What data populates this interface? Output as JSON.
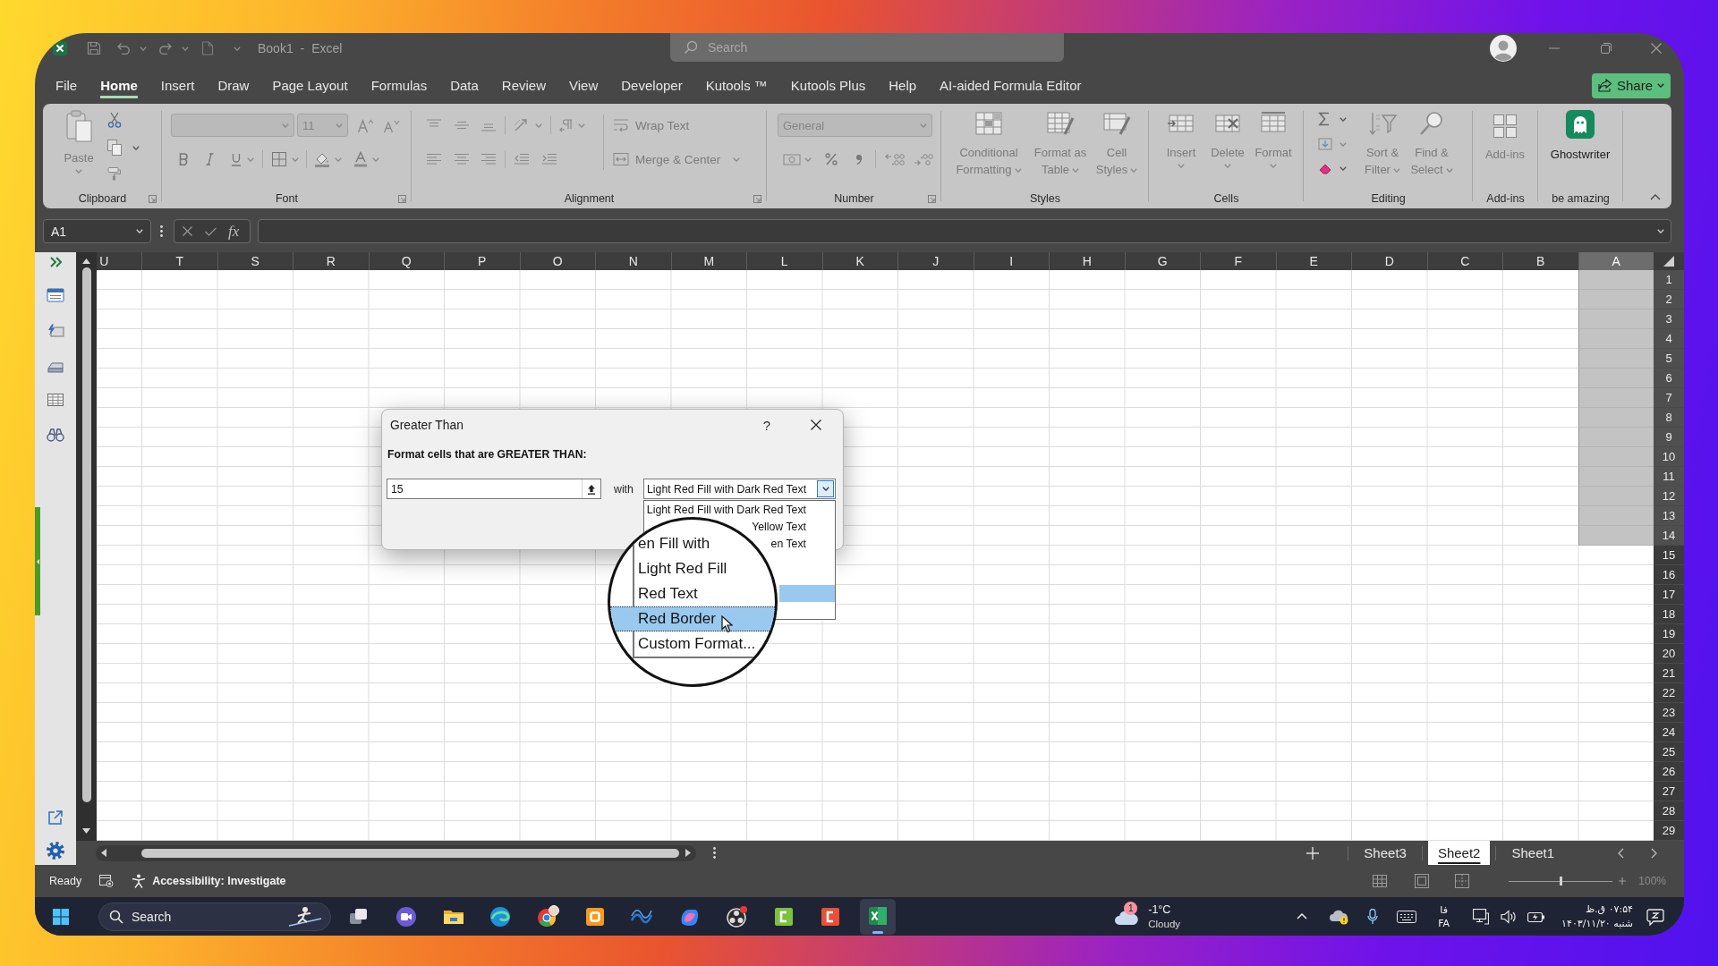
{
  "title_bar": {
    "title": "Book1 - Excel",
    "search": {
      "placeholder": "Search"
    }
  },
  "menu_tabs": [
    {
      "label": "File",
      "selected": false
    },
    {
      "label": "Home",
      "selected": true
    },
    {
      "label": "Insert",
      "selected": false
    },
    {
      "label": "Draw",
      "selected": false
    },
    {
      "label": "Page Layout",
      "selected": false
    },
    {
      "label": "Formulas",
      "selected": false
    },
    {
      "label": "Data",
      "selected": false
    },
    {
      "label": "Review",
      "selected": false
    },
    {
      "label": "View",
      "selected": false
    },
    {
      "label": "Developer",
      "selected": false
    },
    {
      "label": "Kutools ™",
      "selected": false
    },
    {
      "label": "Kutools Plus",
      "selected": false
    },
    {
      "label": "Help",
      "selected": false
    },
    {
      "label": "AI-aided Formula Editor",
      "selected": false
    }
  ],
  "share_button": {
    "label": "Share"
  },
  "ribbon": {
    "groups": [
      {
        "kind": "clipboard",
        "label": "Clipboard",
        "commands": [
          {
            "label": "Paste",
            "disabled": true
          }
        ]
      },
      {
        "kind": "font",
        "label": "Font",
        "font_size": "11"
      },
      {
        "kind": "alignment",
        "label": "Alignment",
        "commands": [
          {
            "label": "Wrap Text",
            "disabled": true
          },
          {
            "label": "Merge & Center",
            "disabled": true
          }
        ]
      },
      {
        "kind": "number",
        "label": "Number",
        "number_format": "General"
      },
      {
        "kind": "styles",
        "label": "Styles",
        "commands": [
          {
            "label": "Conditional Formatting",
            "disabled": true
          },
          {
            "label": "Format as Table",
            "disabled": true
          },
          {
            "label": "Cell Styles",
            "disabled": true
          }
        ]
      },
      {
        "kind": "cells",
        "label": "Cells",
        "commands": [
          {
            "label": "Insert",
            "disabled": true
          },
          {
            "label": "Delete",
            "disabled": true
          },
          {
            "label": "Format",
            "disabled": true
          }
        ]
      },
      {
        "kind": "editing",
        "label": "Editing",
        "commands": [
          {
            "label": "Sort & Filter",
            "disabled": true
          },
          {
            "label": "Find & Select",
            "disabled": true
          }
        ]
      },
      {
        "kind": "addins",
        "label": "Add-ins",
        "commands": [
          {
            "label": "Add-ins",
            "disabled": true
          }
        ]
      },
      {
        "kind": "ghostwriter",
        "label": "be amazing",
        "commands": [
          {
            "label": "Ghostwriter",
            "disabled": false
          }
        ]
      }
    ]
  },
  "formula_bar": {
    "name_box": "A1",
    "function_button": "fx"
  },
  "sheet": {
    "columns": [
      {
        "label": "U",
        "selected": false
      },
      {
        "label": "T",
        "selected": false
      },
      {
        "label": "S",
        "selected": false
      },
      {
        "label": "R",
        "selected": false
      },
      {
        "label": "Q",
        "selected": false
      },
      {
        "label": "P",
        "selected": false
      },
      {
        "label": "O",
        "selected": false
      },
      {
        "label": "N",
        "selected": false
      },
      {
        "label": "M",
        "selected": false
      },
      {
        "label": "L",
        "selected": false
      },
      {
        "label": "K",
        "selected": false
      },
      {
        "label": "J",
        "selected": false
      },
      {
        "label": "I",
        "selected": false
      },
      {
        "label": "H",
        "selected": false
      },
      {
        "label": "G",
        "selected": false
      },
      {
        "label": "F",
        "selected": false
      },
      {
        "label": "E",
        "selected": false
      },
      {
        "label": "D",
        "selected": false
      },
      {
        "label": "C",
        "selected": false
      },
      {
        "label": "B",
        "selected": false
      },
      {
        "label": "A",
        "selected": true
      }
    ],
    "rows": [
      {
        "label": "1",
        "selected": true
      },
      {
        "label": "2",
        "selected": true
      },
      {
        "label": "3",
        "selected": true
      },
      {
        "label": "4",
        "selected": true
      },
      {
        "label": "5",
        "selected": true
      },
      {
        "label": "6",
        "selected": true
      },
      {
        "label": "7",
        "selected": true
      },
      {
        "label": "8",
        "selected": true
      },
      {
        "label": "9",
        "selected": true
      },
      {
        "label": "10",
        "selected": true
      },
      {
        "label": "11",
        "selected": true
      },
      {
        "label": "12",
        "selected": true
      },
      {
        "label": "13",
        "selected": true
      },
      {
        "label": "14",
        "selected": true
      },
      {
        "label": "15",
        "selected": false
      },
      {
        "label": "16",
        "selected": false
      },
      {
        "label": "17",
        "selected": false
      },
      {
        "label": "18",
        "selected": false
      },
      {
        "label": "19",
        "selected": false
      },
      {
        "label": "20",
        "selected": false
      },
      {
        "label": "21",
        "selected": false
      },
      {
        "label": "22",
        "selected": false
      },
      {
        "label": "23",
        "selected": false
      },
      {
        "label": "24",
        "selected": false
      },
      {
        "label": "25",
        "selected": false
      },
      {
        "label": "26",
        "selected": false
      },
      {
        "label": "27",
        "selected": false
      },
      {
        "label": "28",
        "selected": false
      },
      {
        "label": "29",
        "selected": false
      }
    ]
  },
  "sheet_tabs": [
    {
      "label": "Sheet3",
      "selected": false
    },
    {
      "label": "Sheet2",
      "selected": true
    },
    {
      "label": "Sheet1",
      "selected": false
    }
  ],
  "status_bar": {
    "status": "Ready",
    "accessibility": "Accessibility: Investigate",
    "zoom_slider": {
      "level": 0.5
    },
    "zoom": "100%"
  },
  "dialog": {
    "title": "Greater Than",
    "help_button": "?",
    "prompt": "Format cells that are GREATER THAN:",
    "value": "15",
    "with_label": "with",
    "format": "Light Red Fill with Dark Red Text",
    "format_list": [
      {
        "label": "Light Red Fill with Dark Red Text",
        "selected": false
      },
      {
        "label": "Yellow Text",
        "selected": false
      },
      {
        "label": "en Text",
        "selected": false
      },
      {
        "selected": true
      }
    ]
  },
  "magnifier": {
    "items": [
      {
        "label": "en Fill with",
        "selected": false
      },
      {
        "label": "Light Red Fill",
        "selected": false
      },
      {
        "label": "Red Text",
        "selected": false
      },
      {
        "label": "Red Border",
        "selected": true
      },
      {
        "label": "Custom Format...",
        "selected": false
      }
    ]
  },
  "taskbar": {
    "search": {
      "placeholder": "Search"
    },
    "apps": [
      {
        "selected": false
      },
      {
        "selected": false
      },
      {
        "selected": false
      },
      {
        "selected": false
      },
      {
        "selected": false
      },
      {
        "selected": false
      },
      {
        "selected": false
      },
      {
        "selected": false
      },
      {
        "selected": false
      },
      {
        "selected": false
      },
      {
        "selected": false
      },
      {
        "selected": true
      }
    ],
    "weather": {
      "badge": "1",
      "temperature": "-1°C",
      "condition": "Cloudy"
    },
    "language": {
      "script": "فا",
      "code": "FA"
    },
    "clock": {
      "time": "۰۷:۵۴ ق.ظ",
      "date": "شنبه ۱۴۰۳/۱۱/۲۰"
    }
  }
}
